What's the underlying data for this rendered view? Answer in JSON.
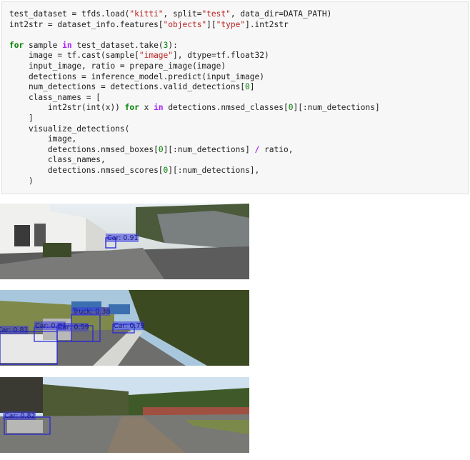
{
  "code_cell": {
    "lines": [
      [
        {
          "t": "test_dataset = tfds.load("
        },
        {
          "t": "\"kitti\"",
          "c": "str"
        },
        {
          "t": ", split="
        },
        {
          "t": "\"test\"",
          "c": "str"
        },
        {
          "t": ", data_dir=DATA_PATH)"
        }
      ],
      [
        {
          "t": "int2str = dataset_info.features["
        },
        {
          "t": "\"objects\"",
          "c": "str"
        },
        {
          "t": "]["
        },
        {
          "t": "\"type\"",
          "c": "str"
        },
        {
          "t": "].int2str"
        }
      ],
      [
        {
          "t": ""
        }
      ],
      [
        {
          "t": "for",
          "c": "kw"
        },
        {
          "t": " sample "
        },
        {
          "t": "in",
          "c": "kwp"
        },
        {
          "t": " test_dataset.take("
        },
        {
          "t": "3",
          "c": "num"
        },
        {
          "t": "):"
        }
      ],
      [
        {
          "t": "    image = tf.cast(sample["
        },
        {
          "t": "\"image\"",
          "c": "str"
        },
        {
          "t": "], dtype=tf.float32)"
        }
      ],
      [
        {
          "t": "    input_image, ratio = prepare_image(image)"
        }
      ],
      [
        {
          "t": "    detections = inference_model.predict(input_image)"
        }
      ],
      [
        {
          "t": "    num_detections = detections.valid_detections["
        },
        {
          "t": "0",
          "c": "num"
        },
        {
          "t": "]"
        }
      ],
      [
        {
          "t": "    class_names = ["
        }
      ],
      [
        {
          "t": "        int2str(int(x)) "
        },
        {
          "t": "for",
          "c": "kw"
        },
        {
          "t": " x "
        },
        {
          "t": "in",
          "c": "kwp"
        },
        {
          "t": " detections.nmsed_classes["
        },
        {
          "t": "0",
          "c": "num"
        },
        {
          "t": "][:num_detections]"
        }
      ],
      [
        {
          "t": "    ]"
        }
      ],
      [
        {
          "t": "    visualize_detections("
        }
      ],
      [
        {
          "t": "        image,"
        }
      ],
      [
        {
          "t": "        detections.nmsed_boxes["
        },
        {
          "t": "0",
          "c": "num"
        },
        {
          "t": "][:num_detections] "
        },
        {
          "t": "/",
          "c": "op"
        },
        {
          "t": " ratio,"
        }
      ],
      [
        {
          "t": "        class_names,"
        }
      ],
      [
        {
          "t": "        detections.nmsed_scores["
        },
        {
          "t": "0",
          "c": "num"
        },
        {
          "t": "][:num_detections],"
        }
      ],
      [
        {
          "t": "    )"
        }
      ]
    ]
  },
  "outputs": [
    {
      "detections": [
        {
          "label": "Car: 0.91"
        }
      ]
    },
    {
      "detections": [
        {
          "label": "Truck: 0.38"
        },
        {
          "label": "Car: 0.81"
        },
        {
          "label": "Car: 0.64"
        },
        {
          "label": "Car: 0.59"
        },
        {
          "label": "Car: 0.79"
        }
      ]
    },
    {
      "detections": [
        {
          "label": "Car: 0.82"
        }
      ]
    }
  ],
  "colors": {
    "box": "#2222dd",
    "label_bg": "#3a3ae0",
    "code_bg": "#f7f7f7"
  }
}
